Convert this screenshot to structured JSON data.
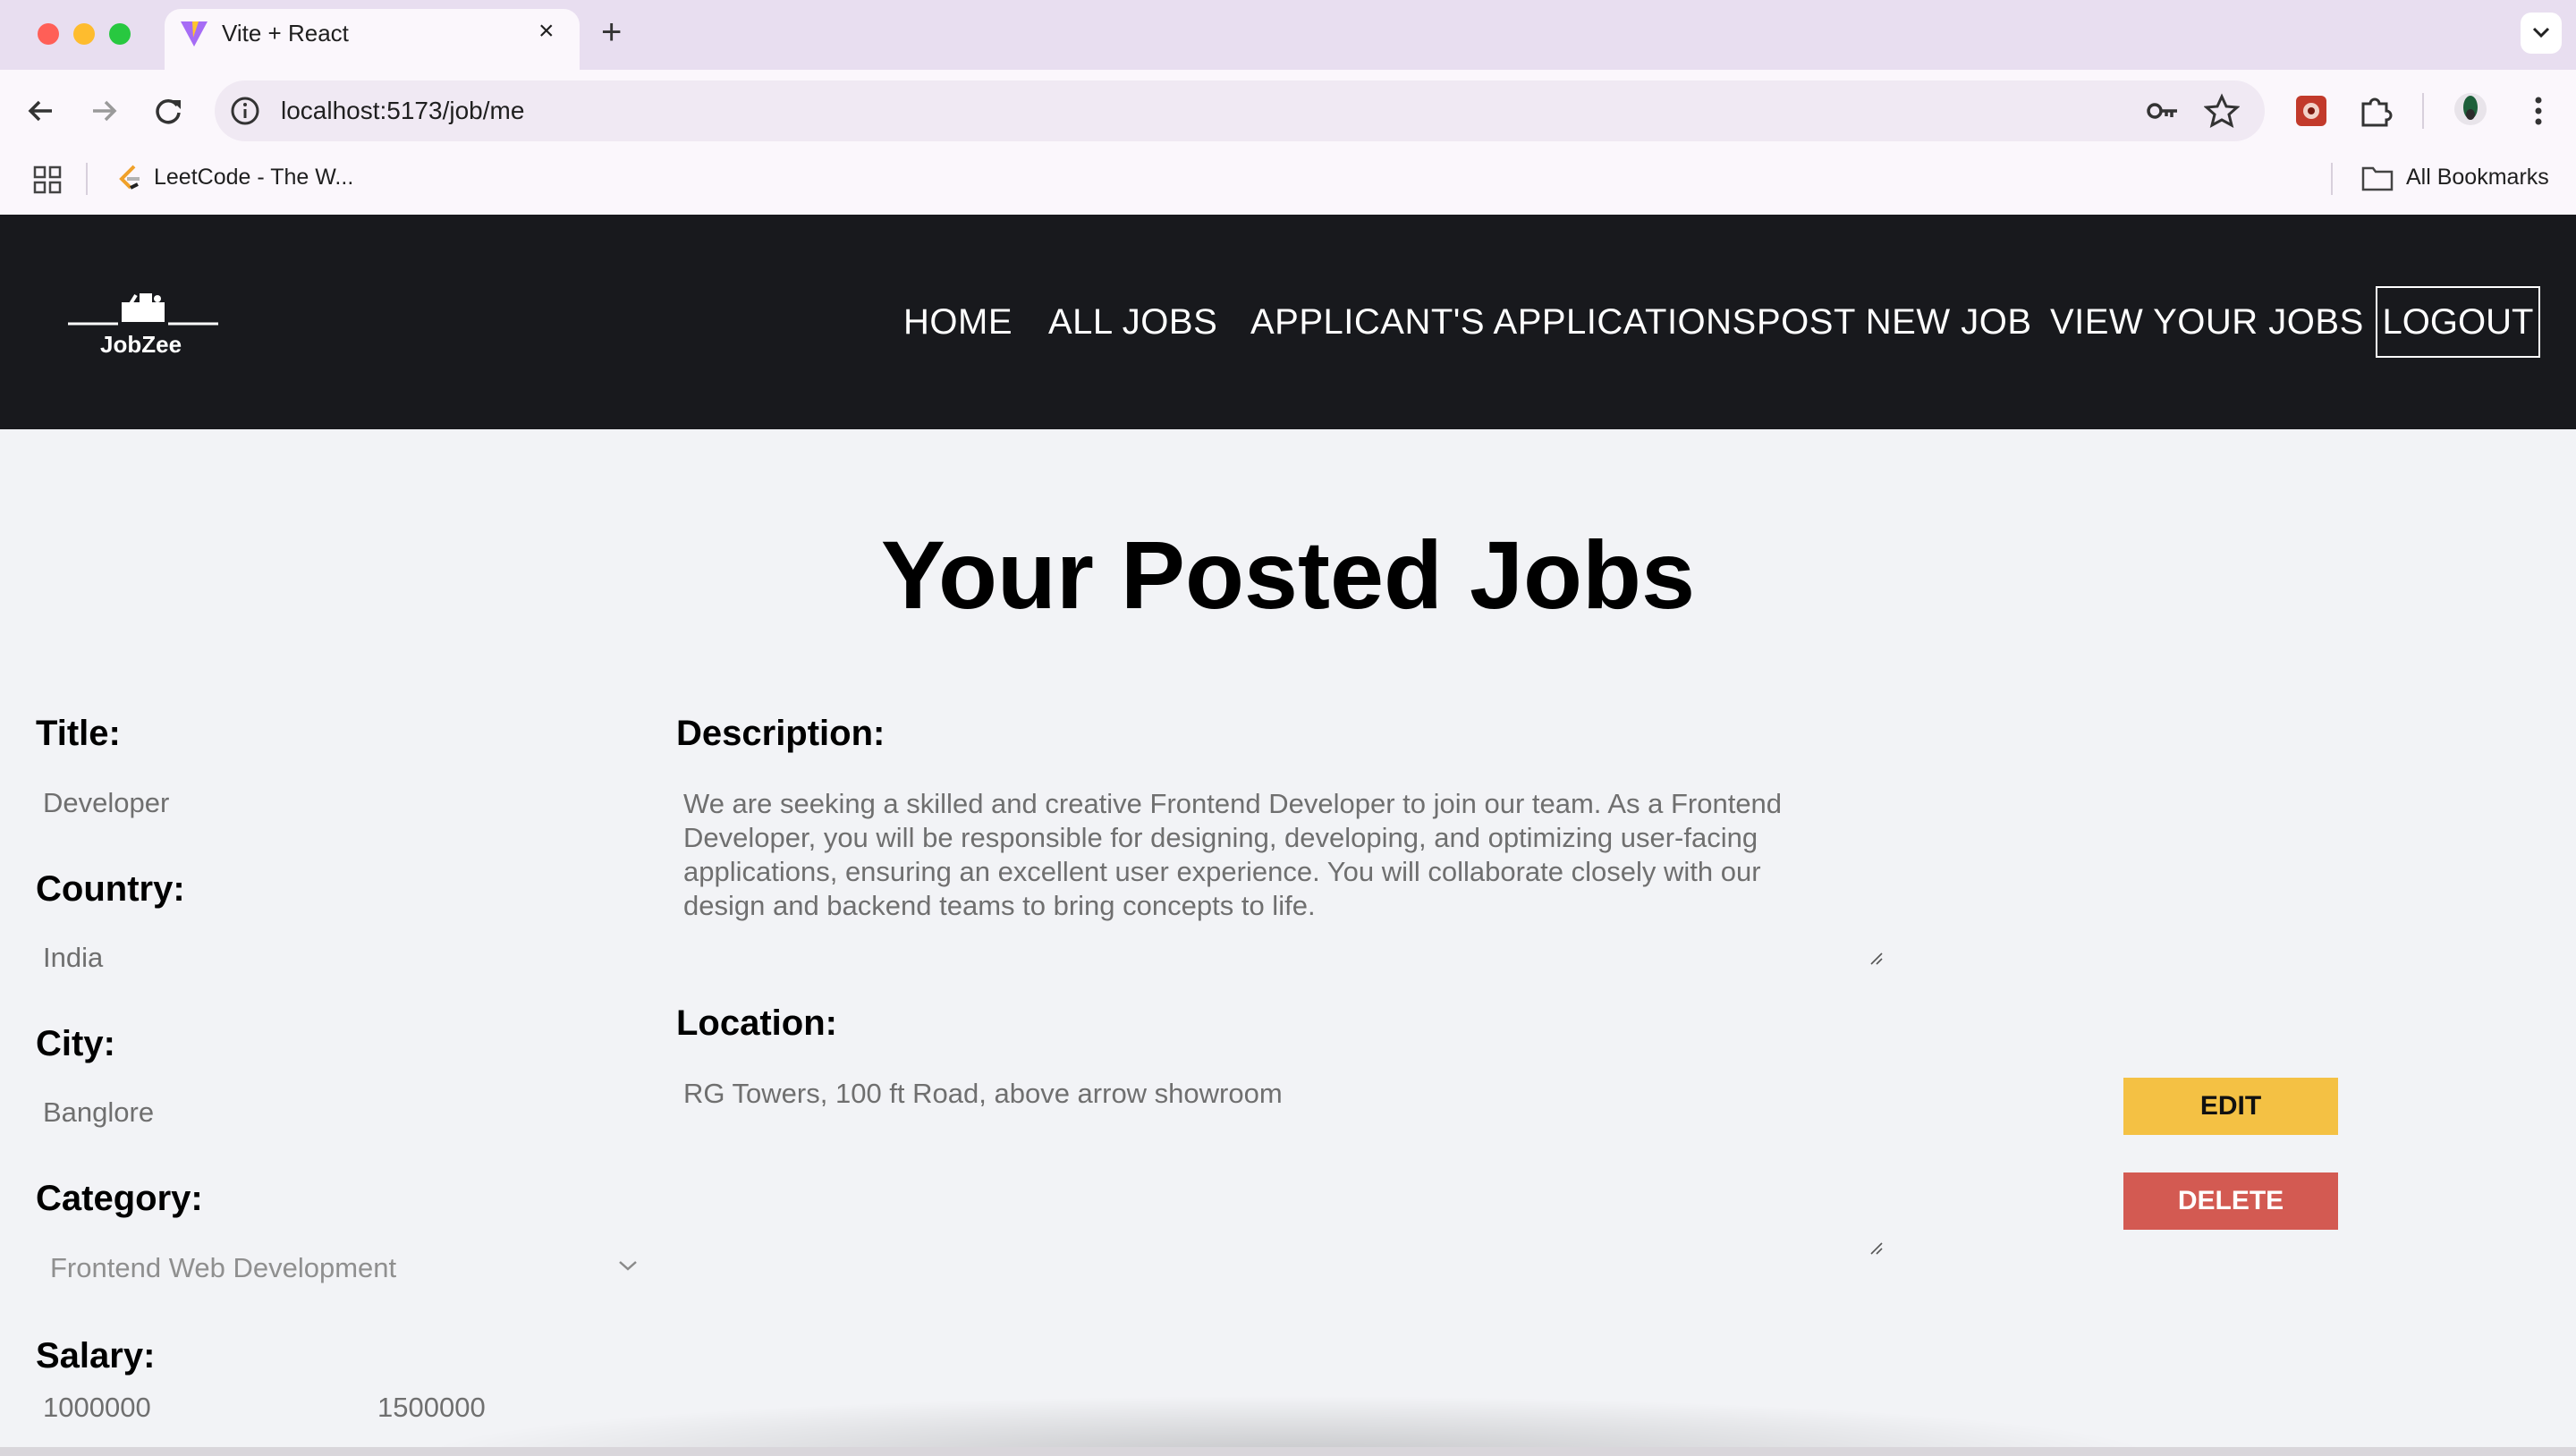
{
  "browser": {
    "tab_title": "Vite + React",
    "url": "localhost:5173/job/me",
    "bookmarks": [
      {
        "label": "LeetCode - The W..."
      }
    ],
    "all_bookmarks_label": "All Bookmarks"
  },
  "app": {
    "logo_text": "JobZee",
    "nav": {
      "home": "HOME",
      "all_jobs": "ALL JOBS",
      "applications": "APPLICANT'S APPLICATIONS",
      "post_job": "POST NEW JOB",
      "view_jobs": "VIEW YOUR JOBS",
      "logout": "LOGOUT"
    },
    "page_title": "Your Posted Jobs",
    "job": {
      "title_label": "Title:",
      "title_value": "Developer",
      "country_label": "Country:",
      "country_value": "India",
      "city_label": "City:",
      "city_value": "Banglore",
      "category_label": "Category:",
      "category_value": "Frontend Web Development",
      "salary_label": "Salary:",
      "salary_from": "1000000",
      "salary_to": "1500000",
      "description_label": "Description:",
      "description_value": "We are seeking a skilled and creative Frontend Developer to join our team. As a Frontend Developer, you will be responsible for designing, developing, and optimizing user-facing applications, ensuring an excellent user experience. You will collaborate closely with our design and backend teams to bring concepts to life.",
      "location_label": "Location:",
      "location_value": "RG Towers, 100 ft Road, above arrow showroom",
      "edit_label": "EDIT",
      "delete_label": "DELETE"
    }
  },
  "colors": {
    "navbar_bg": "#18191d",
    "page_bg": "#f2f3f6",
    "edit_button": "#f4c144",
    "delete_button": "#d35a52"
  }
}
